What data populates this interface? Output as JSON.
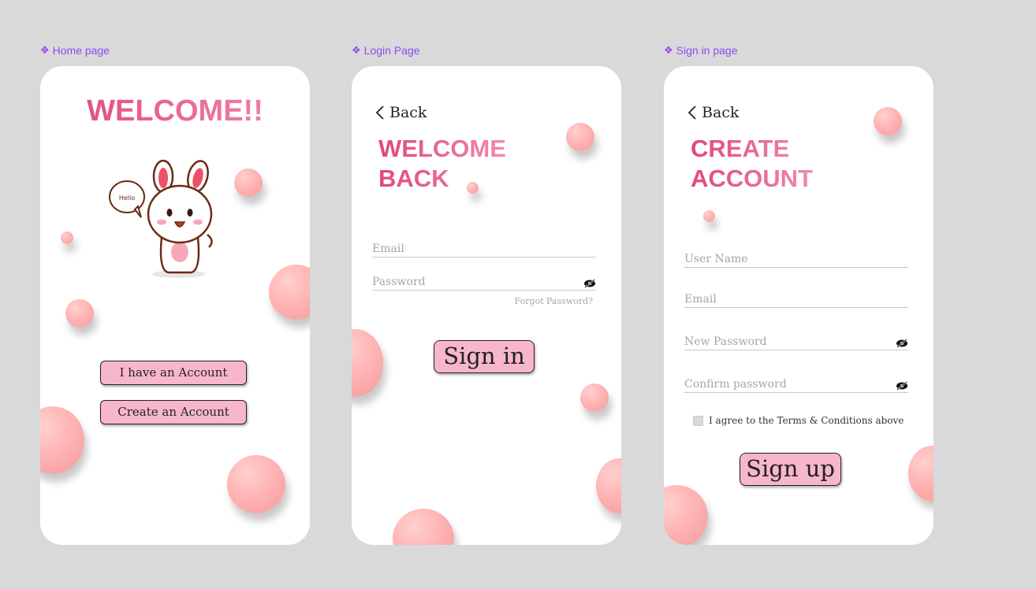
{
  "frames": {
    "home": {
      "label": "Home page"
    },
    "login": {
      "label": "Login Page"
    },
    "signup": {
      "label": "Sign in page"
    }
  },
  "home": {
    "title": "WELCOME!!",
    "speech_bubble": "Hello",
    "have_account_btn": "I have an Account",
    "create_account_btn": "Create an Account"
  },
  "login": {
    "back": "Back",
    "title_line1": "WELCOME",
    "title_line2": "BACK",
    "email_placeholder": "Email",
    "password_placeholder": "Password",
    "forgot_password": "Forgot Password?",
    "sign_in_btn": "Sign in"
  },
  "signup": {
    "back": "Back",
    "title_line1": "CREATE",
    "title_line2": "ACCOUNT",
    "username_placeholder": "User Name",
    "email_placeholder": "Email",
    "new_password_placeholder": "New Password",
    "confirm_password_placeholder": "Confirm password",
    "terms_label": "I agree to the Terms & Conditions above",
    "sign_up_btn": "Sign up"
  },
  "colors": {
    "background": "#d9d9d9",
    "frame_label": "#8a4cf0",
    "title_gradient_start": "#e0467f",
    "title_gradient_end": "#f08ab0",
    "button_fill": "#f7b6cd",
    "ball": "#ffb4b4"
  }
}
